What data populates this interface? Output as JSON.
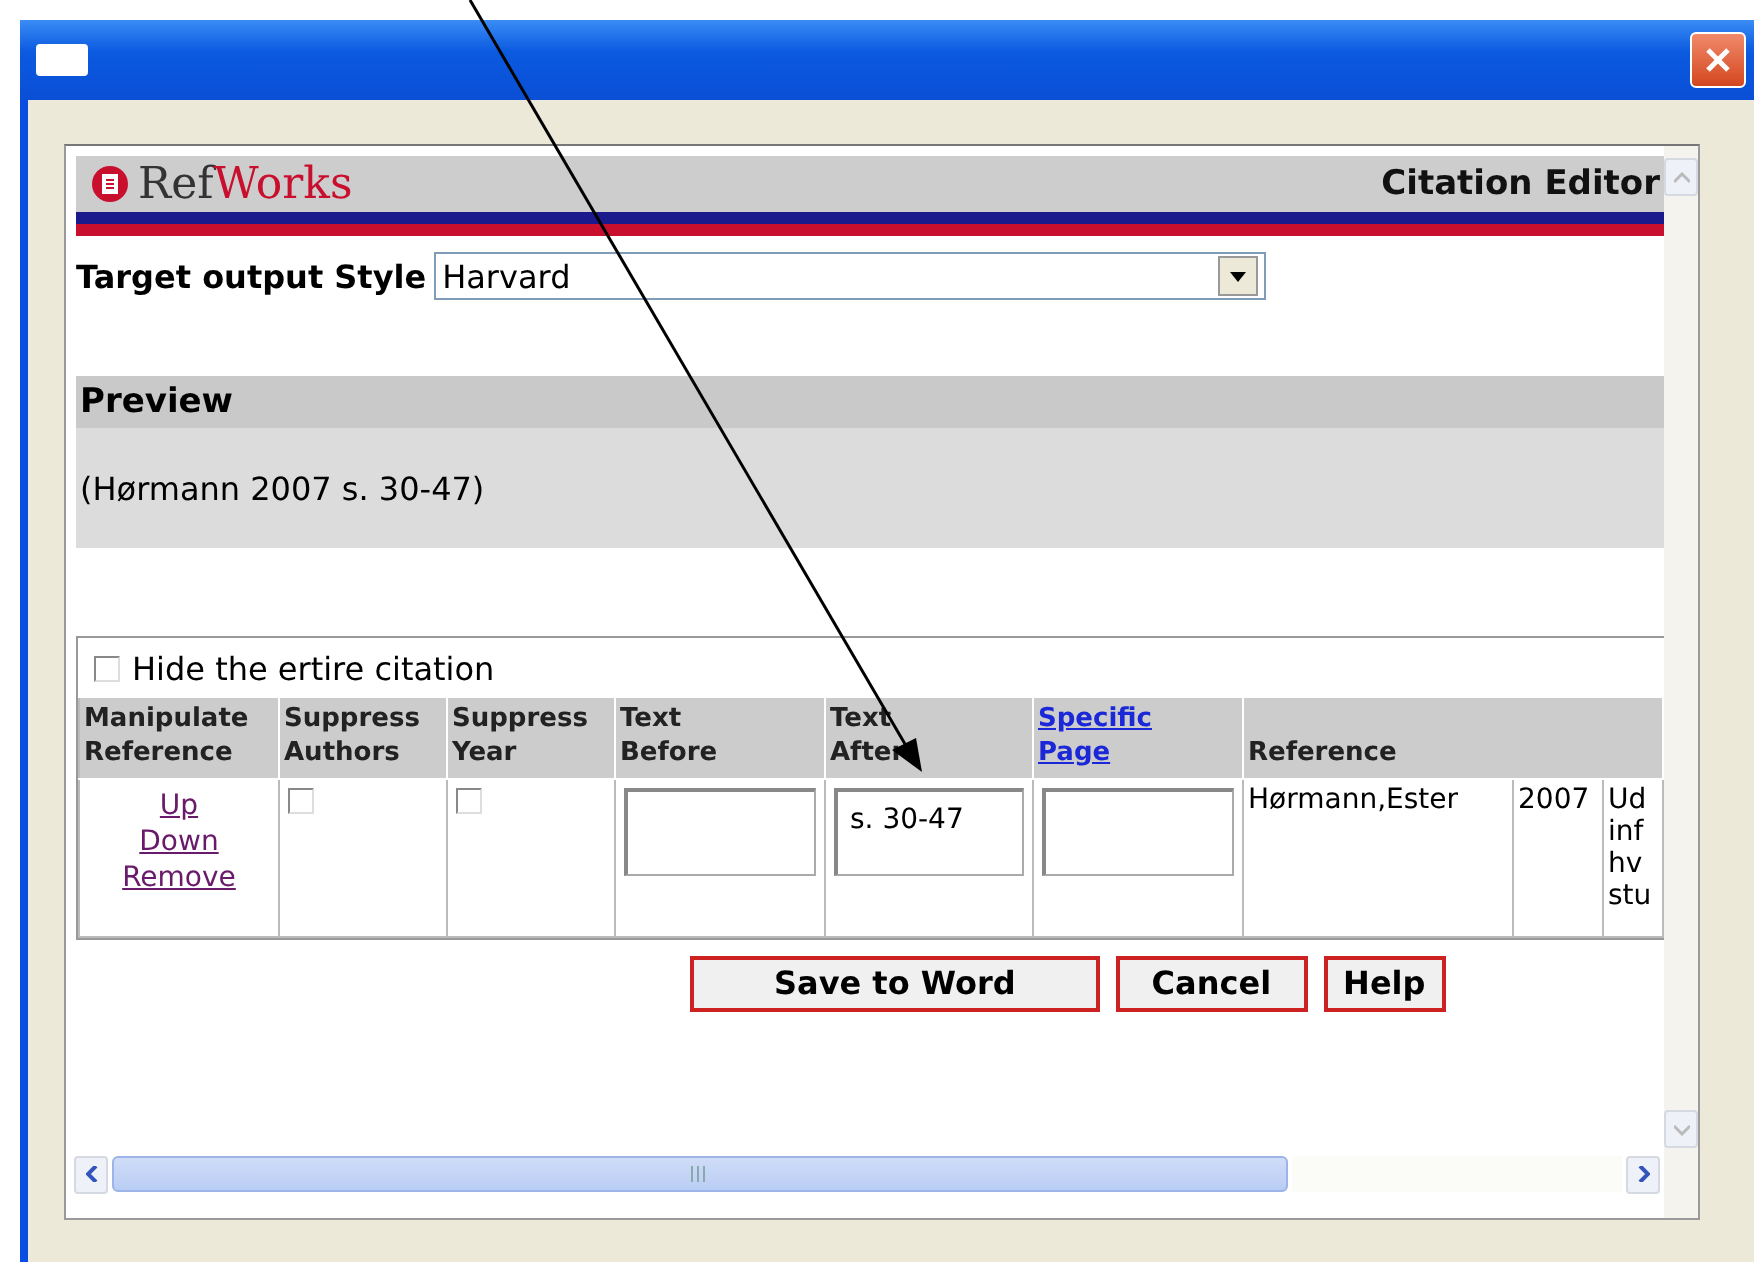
{
  "logo": {
    "part_1": "Ref",
    "part_2": "Works"
  },
  "page_title": "Citation Editor",
  "output_style": {
    "label": "Target output Style",
    "value": "Harvard"
  },
  "preview": {
    "heading": "Preview",
    "text": "(Hørmann 2007 s. 30-47)"
  },
  "hide_citation": {
    "label": "Hide the ertire citation",
    "checked": false
  },
  "table": {
    "columns": [
      {
        "label": "Manipulate Reference",
        "link": false
      },
      {
        "label": "Suppress Authors",
        "link": false
      },
      {
        "label": "Suppress Year",
        "link": false
      },
      {
        "label": "Text Before",
        "link": false
      },
      {
        "label": "Text After",
        "link": false
      },
      {
        "label": "Specific Page",
        "link": true
      },
      {
        "label": "Reference",
        "link": false
      }
    ],
    "rows": [
      {
        "actions": [
          "Up",
          "Down",
          "Remove"
        ],
        "suppress_authors": false,
        "suppress_year": false,
        "text_after": "s. 30-47",
        "reference": [
          "Hørmann,Ester",
          "2007",
          [
            "Ud",
            "inf",
            "hv",
            "stu"
          ]
        ]
      }
    ]
  },
  "buttons": [
    "Save to Word",
    "Cancel",
    "Help"
  ]
}
